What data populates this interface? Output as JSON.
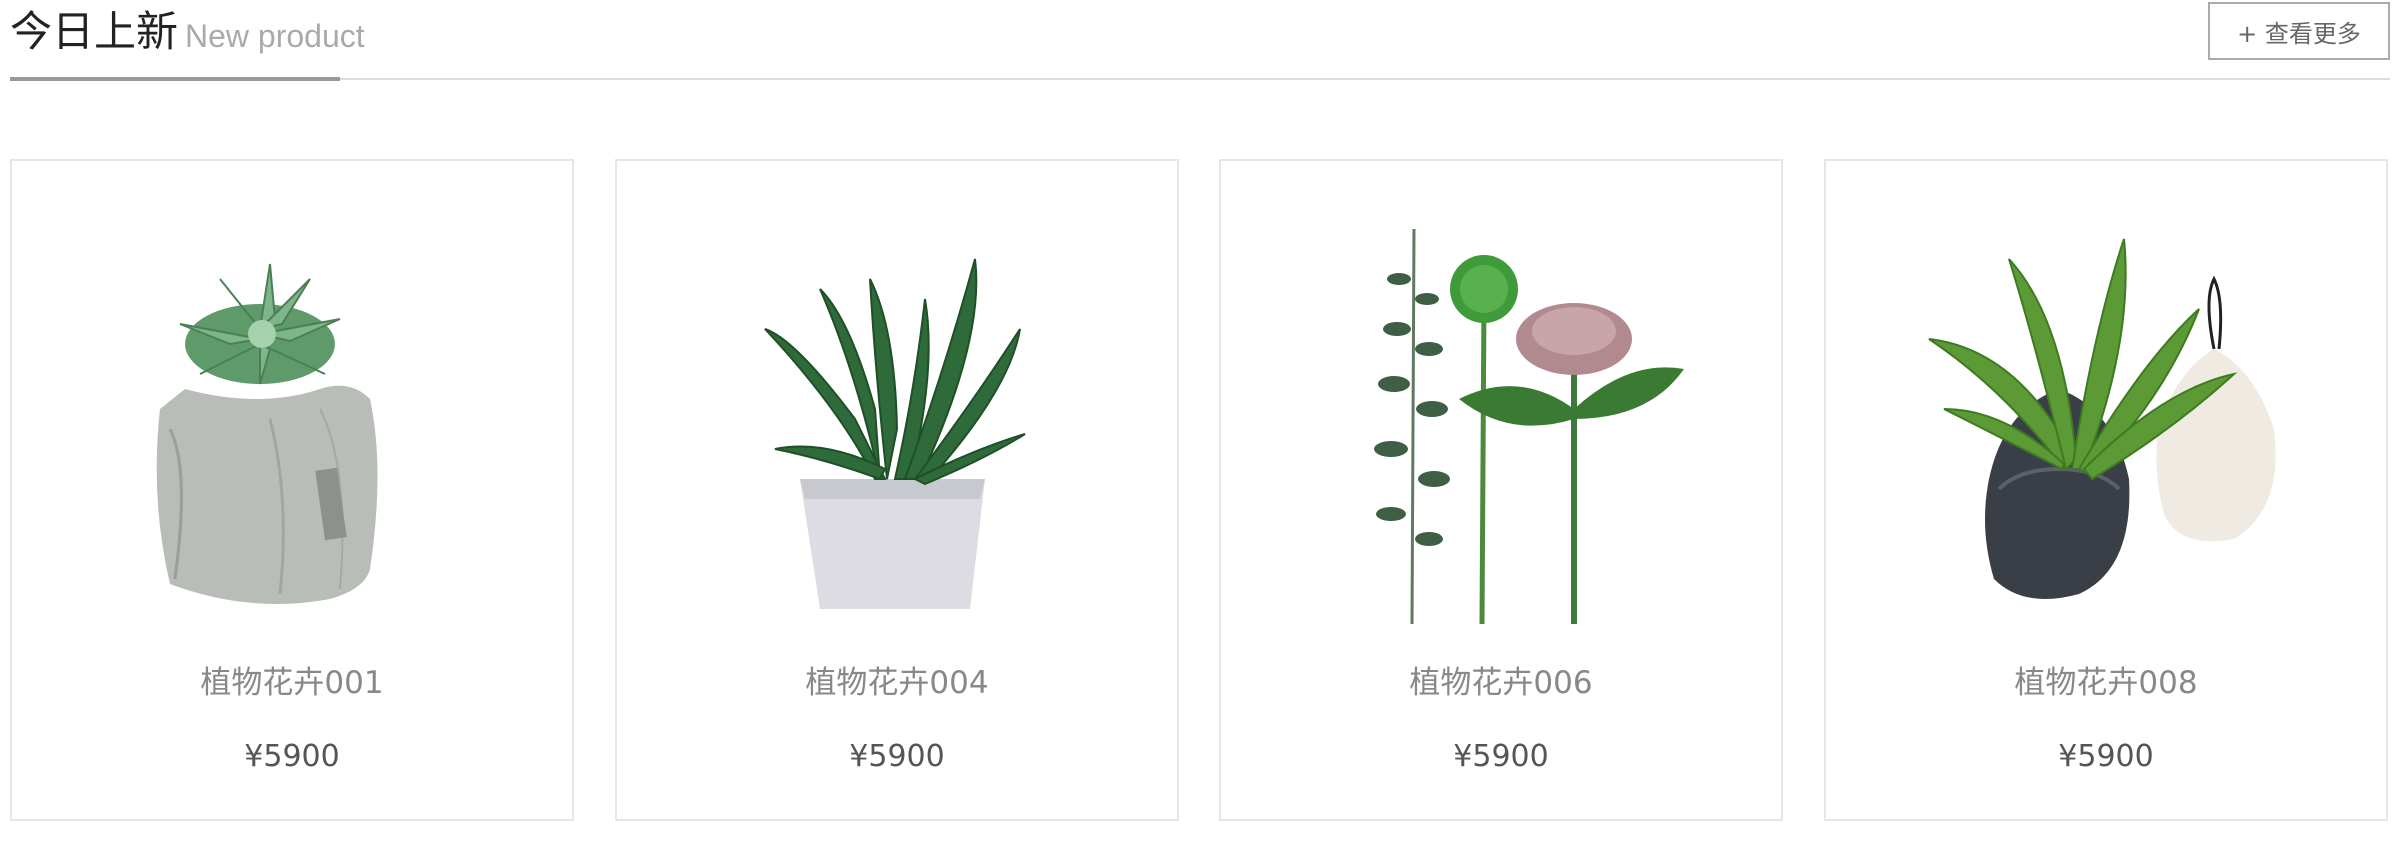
{
  "header": {
    "title": "今日上新",
    "subtitle": "New product",
    "more_label": "+ 查看更多"
  },
  "products": [
    {
      "name": "植物花卉001",
      "price": "¥5900",
      "image_icon": "succulent-in-paper-bag-icon"
    },
    {
      "name": "植物花卉004",
      "price": "¥5900",
      "image_icon": "cactus-in-white-pot-icon"
    },
    {
      "name": "植物花卉006",
      "price": "¥5900",
      "image_icon": "flower-stems-icon"
    },
    {
      "name": "植物花卉008",
      "price": "¥5900",
      "image_icon": "plant-in-hanging-pots-icon"
    }
  ],
  "colors": {
    "underline": "#999999",
    "border": "#e6e6e6",
    "text_muted": "#888888"
  }
}
